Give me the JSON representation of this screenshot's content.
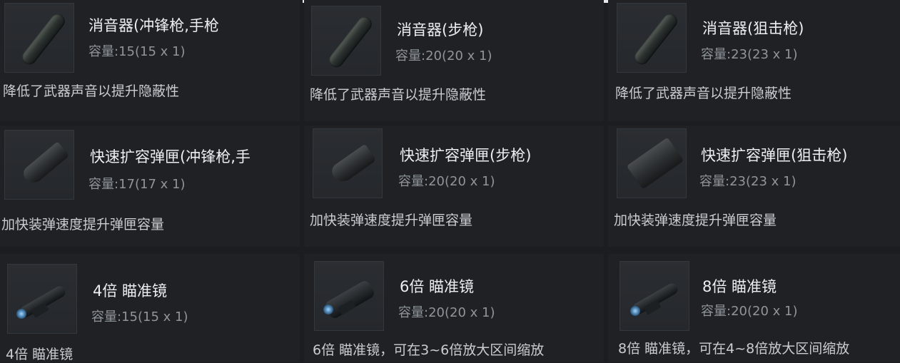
{
  "items": [
    {
      "title": "消音器(冲锋枪,手枪",
      "capacity": "容量:15(15 x 1)",
      "desc": "降低了武器声音以提升隐蔽性",
      "icon": "suppressor-icon"
    },
    {
      "title": "消音器(步枪)",
      "capacity": "容量:20(20 x 1)",
      "desc": "降低了武器声音以提升隐蔽性",
      "icon": "suppressor-icon"
    },
    {
      "title": "消音器(狙击枪)",
      "capacity": "容量:23(23 x 1)",
      "desc": "降低了武器声音以提升隐蔽性",
      "icon": "suppressor-icon"
    },
    {
      "title": "快速扩容弹匣(冲锋枪,手",
      "capacity": "容量:17(17 x 1)",
      "desc": "加快装弹速度提升弹匣容量",
      "icon": "magazine-icon"
    },
    {
      "title": "快速扩容弹匣(步枪)",
      "capacity": "容量:20(20 x 1)",
      "desc": "加快装弹速度提升弹匣容量",
      "icon": "magazine-icon"
    },
    {
      "title": "快速扩容弹匣(狙击枪)",
      "capacity": "容量:23(23 x 1)",
      "desc": "加快装弹速度提升弹匣容量",
      "icon": "magazine-icon"
    },
    {
      "title": "4倍 瞄准镜",
      "capacity": "容量:15(15 x 1)",
      "desc": "4倍 瞄准镜",
      "icon": "scope-icon"
    },
    {
      "title": "6倍 瞄准镜",
      "capacity": "容量:20(20 x 1)",
      "desc": "6倍 瞄准镜，可在3~6倍放大区间缩放",
      "icon": "scope-icon"
    },
    {
      "title": "8倍 瞄准镜",
      "capacity": "容量:20(20 x 1)",
      "desc": "8倍 瞄准镜，可在4~8倍放大区间缩放",
      "icon": "scope-icon"
    }
  ]
}
